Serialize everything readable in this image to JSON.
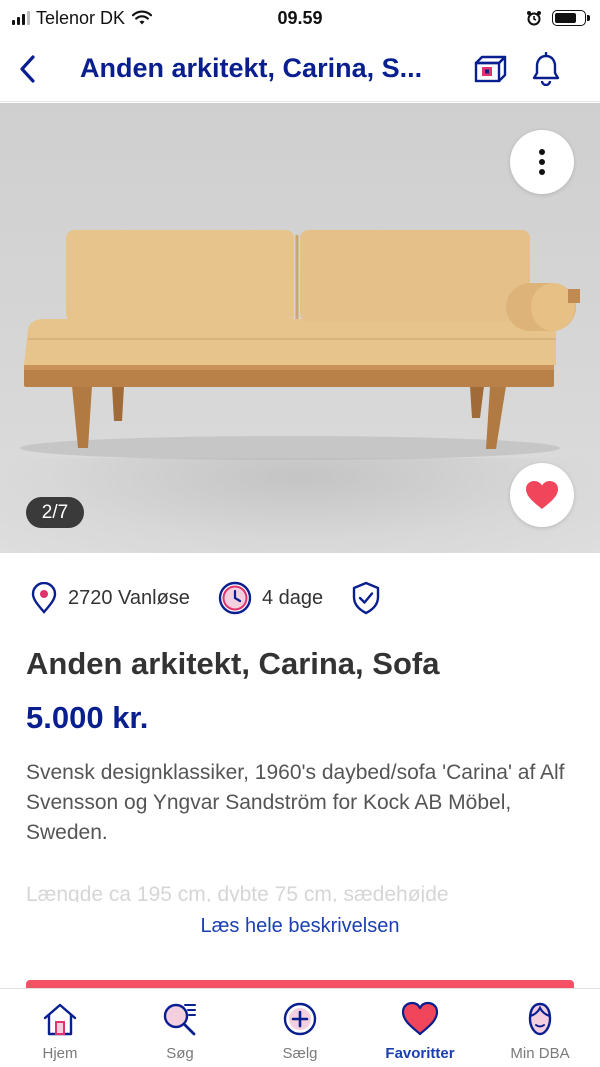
{
  "status_bar": {
    "carrier": "Telenor DK",
    "time": "09.59",
    "battery_level": 0.75
  },
  "header": {
    "title": "Anden arkitekt, Carina, S...",
    "icons": [
      "back-chevron-icon",
      "dba-shipping-icon",
      "bell-icon"
    ]
  },
  "gallery": {
    "counter": "2/7",
    "favorited": true,
    "colors": {
      "heart": "#f0455a"
    }
  },
  "info": {
    "location": "2720 Vanløse",
    "age": "4 dage"
  },
  "listing": {
    "title": "Anden arkitekt, Carina, Sofa",
    "price": "5.000 kr.",
    "description": "Svensk designklassiker, 1960's daybed/sofa 'Carina' af Alf Svensson og Yngvar Sandström for Kock AB Möbel, Sweden.",
    "description_faded": "Længde ca 195 cm, dybte 75 cm, sædehøjde",
    "read_more": "Læs hele beskrivelsen"
  },
  "tabs": [
    {
      "label": "Hjem",
      "icon": "home-icon",
      "active": false
    },
    {
      "label": "Søg",
      "icon": "search-icon",
      "active": false
    },
    {
      "label": "Sælg",
      "icon": "plus-circle-icon",
      "active": false
    },
    {
      "label": "Favoritter",
      "icon": "heart-icon",
      "active": true
    },
    {
      "label": "Min DBA",
      "icon": "profile-icon",
      "active": false
    }
  ],
  "colors": {
    "brand_blue": "#0a1f8f",
    "link_blue": "#1a3fb0",
    "accent_red": "#f25264",
    "icon_pink": "#e0336e"
  }
}
